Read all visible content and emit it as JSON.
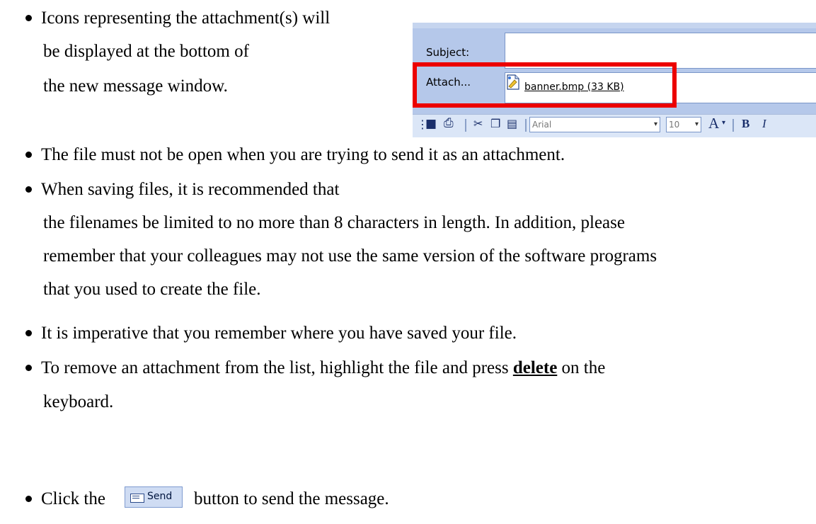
{
  "mail_window": {
    "subject_label": "Subject:",
    "attach_label": "Attach...",
    "attachment_name": "banner.bmp (33 KB)",
    "font_name": "Arial",
    "font_size": "10",
    "highlight_color": "#ec0000"
  },
  "bullets": {
    "b1_l1": "Icons representing the attachment(s) will",
    "b1_l2": "be displayed at the bottom of",
    "b1_l3": "the new message window.",
    "b2": "The file must not be open when you are trying to send it as an attachment.",
    "b3_l1": "When saving files, it is recommended that",
    "b3_l2": "the filenames be limited to no more than 8 characters in length.  In addition, please",
    "b3_l3": "remember that your colleagues may not use the same version of the software programs",
    "b3_l4": "that you used to create the file.",
    "b4": "It is imperative that you remember where you have saved your file.",
    "b5_pre": "To remove an attachment from the list, highlight the file and press",
    "b5_key": "delete",
    "b5_post": "on the",
    "b5_l2": "keyboard.",
    "b6_pre": "Click the",
    "b6_post": "button to send the message.",
    "send_button_label": "Send"
  }
}
